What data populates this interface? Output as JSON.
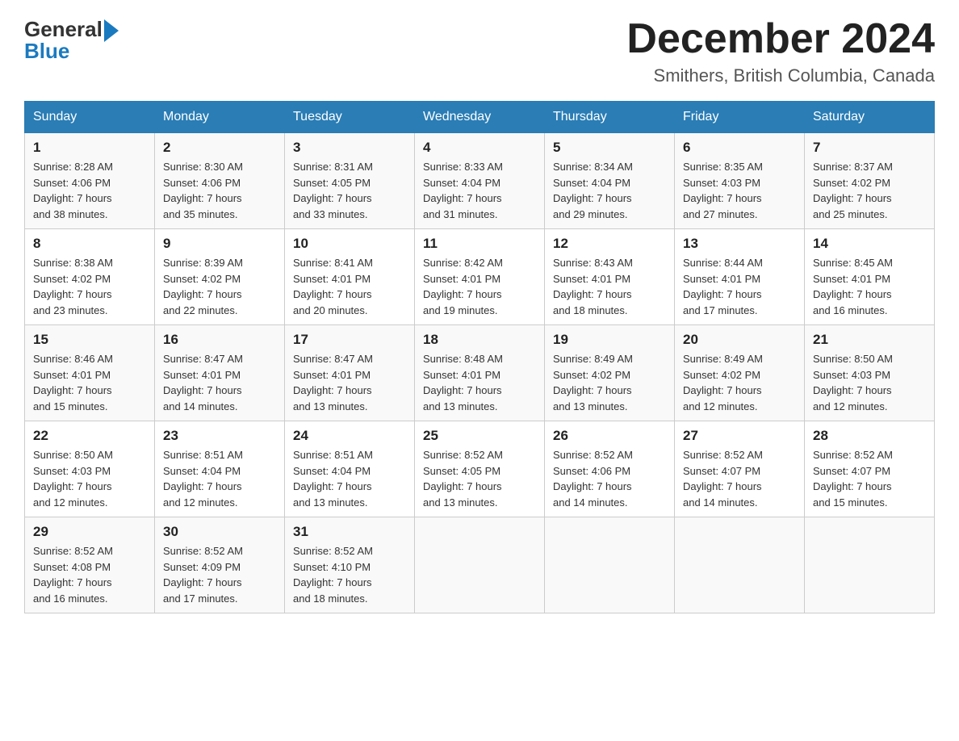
{
  "header": {
    "logo": {
      "general": "General",
      "blue": "Blue"
    },
    "title": "December 2024",
    "location": "Smithers, British Columbia, Canada"
  },
  "weekdays": [
    "Sunday",
    "Monday",
    "Tuesday",
    "Wednesday",
    "Thursday",
    "Friday",
    "Saturday"
  ],
  "weeks": [
    [
      {
        "day": "1",
        "sunrise": "8:28 AM",
        "sunset": "4:06 PM",
        "daylight": "7 hours and 38 minutes."
      },
      {
        "day": "2",
        "sunrise": "8:30 AM",
        "sunset": "4:06 PM",
        "daylight": "7 hours and 35 minutes."
      },
      {
        "day": "3",
        "sunrise": "8:31 AM",
        "sunset": "4:05 PM",
        "daylight": "7 hours and 33 minutes."
      },
      {
        "day": "4",
        "sunrise": "8:33 AM",
        "sunset": "4:04 PM",
        "daylight": "7 hours and 31 minutes."
      },
      {
        "day": "5",
        "sunrise": "8:34 AM",
        "sunset": "4:04 PM",
        "daylight": "7 hours and 29 minutes."
      },
      {
        "day": "6",
        "sunrise": "8:35 AM",
        "sunset": "4:03 PM",
        "daylight": "7 hours and 27 minutes."
      },
      {
        "day": "7",
        "sunrise": "8:37 AM",
        "sunset": "4:02 PM",
        "daylight": "7 hours and 25 minutes."
      }
    ],
    [
      {
        "day": "8",
        "sunrise": "8:38 AM",
        "sunset": "4:02 PM",
        "daylight": "7 hours and 23 minutes."
      },
      {
        "day": "9",
        "sunrise": "8:39 AM",
        "sunset": "4:02 PM",
        "daylight": "7 hours and 22 minutes."
      },
      {
        "day": "10",
        "sunrise": "8:41 AM",
        "sunset": "4:01 PM",
        "daylight": "7 hours and 20 minutes."
      },
      {
        "day": "11",
        "sunrise": "8:42 AM",
        "sunset": "4:01 PM",
        "daylight": "7 hours and 19 minutes."
      },
      {
        "day": "12",
        "sunrise": "8:43 AM",
        "sunset": "4:01 PM",
        "daylight": "7 hours and 18 minutes."
      },
      {
        "day": "13",
        "sunrise": "8:44 AM",
        "sunset": "4:01 PM",
        "daylight": "7 hours and 17 minutes."
      },
      {
        "day": "14",
        "sunrise": "8:45 AM",
        "sunset": "4:01 PM",
        "daylight": "7 hours and 16 minutes."
      }
    ],
    [
      {
        "day": "15",
        "sunrise": "8:46 AM",
        "sunset": "4:01 PM",
        "daylight": "7 hours and 15 minutes."
      },
      {
        "day": "16",
        "sunrise": "8:47 AM",
        "sunset": "4:01 PM",
        "daylight": "7 hours and 14 minutes."
      },
      {
        "day": "17",
        "sunrise": "8:47 AM",
        "sunset": "4:01 PM",
        "daylight": "7 hours and 13 minutes."
      },
      {
        "day": "18",
        "sunrise": "8:48 AM",
        "sunset": "4:01 PM",
        "daylight": "7 hours and 13 minutes."
      },
      {
        "day": "19",
        "sunrise": "8:49 AM",
        "sunset": "4:02 PM",
        "daylight": "7 hours and 13 minutes."
      },
      {
        "day": "20",
        "sunrise": "8:49 AM",
        "sunset": "4:02 PM",
        "daylight": "7 hours and 12 minutes."
      },
      {
        "day": "21",
        "sunrise": "8:50 AM",
        "sunset": "4:03 PM",
        "daylight": "7 hours and 12 minutes."
      }
    ],
    [
      {
        "day": "22",
        "sunrise": "8:50 AM",
        "sunset": "4:03 PM",
        "daylight": "7 hours and 12 minutes."
      },
      {
        "day": "23",
        "sunrise": "8:51 AM",
        "sunset": "4:04 PM",
        "daylight": "7 hours and 12 minutes."
      },
      {
        "day": "24",
        "sunrise": "8:51 AM",
        "sunset": "4:04 PM",
        "daylight": "7 hours and 13 minutes."
      },
      {
        "day": "25",
        "sunrise": "8:52 AM",
        "sunset": "4:05 PM",
        "daylight": "7 hours and 13 minutes."
      },
      {
        "day": "26",
        "sunrise": "8:52 AM",
        "sunset": "4:06 PM",
        "daylight": "7 hours and 14 minutes."
      },
      {
        "day": "27",
        "sunrise": "8:52 AM",
        "sunset": "4:07 PM",
        "daylight": "7 hours and 14 minutes."
      },
      {
        "day": "28",
        "sunrise": "8:52 AM",
        "sunset": "4:07 PM",
        "daylight": "7 hours and 15 minutes."
      }
    ],
    [
      {
        "day": "29",
        "sunrise": "8:52 AM",
        "sunset": "4:08 PM",
        "daylight": "7 hours and 16 minutes."
      },
      {
        "day": "30",
        "sunrise": "8:52 AM",
        "sunset": "4:09 PM",
        "daylight": "7 hours and 17 minutes."
      },
      {
        "day": "31",
        "sunrise": "8:52 AM",
        "sunset": "4:10 PM",
        "daylight": "7 hours and 18 minutes."
      },
      null,
      null,
      null,
      null
    ]
  ],
  "labels": {
    "sunrise": "Sunrise:",
    "sunset": "Sunset:",
    "daylight": "Daylight:"
  },
  "colors": {
    "header_bg": "#2a7db5",
    "header_text": "#ffffff"
  }
}
